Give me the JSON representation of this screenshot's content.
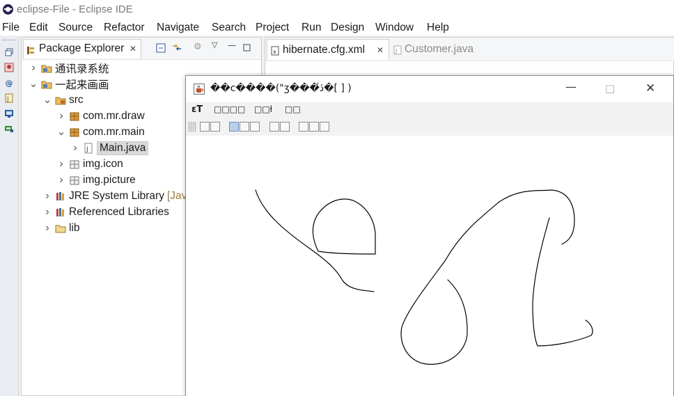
{
  "window": {
    "title": "eclipse-File - Eclipse IDE"
  },
  "menu": [
    "File",
    "Edit",
    "Source",
    "Refactor",
    "Navigate",
    "Search",
    "Project",
    "Run",
    "Design",
    "Window",
    "Help"
  ],
  "package_explorer": {
    "tab_label": "Package Explorer",
    "tree": [
      {
        "label": "通讯录系统",
        "icon": "project-icon",
        "indent": 0,
        "chevron": "right"
      },
      {
        "label": "一起来画画",
        "icon": "project-icon",
        "indent": 0,
        "chevron": "down"
      },
      {
        "label": "src",
        "icon": "source-folder-icon",
        "indent": 1,
        "chevron": "down"
      },
      {
        "label": "com.mr.draw",
        "icon": "package-icon",
        "indent": 2,
        "chevron": "right"
      },
      {
        "label": "com.mr.main",
        "icon": "package-icon",
        "indent": 2,
        "chevron": "down"
      },
      {
        "label": "Main.java",
        "icon": "java-file-icon",
        "indent": 3,
        "chevron": "right",
        "selected": true
      },
      {
        "label": "img.icon",
        "icon": "package-folder-icon",
        "indent": 2,
        "chevron": "right"
      },
      {
        "label": "img.picture",
        "icon": "package-folder-icon",
        "indent": 2,
        "chevron": "right"
      },
      {
        "label": "JRE System Library",
        "suffix": "[Java",
        "icon": "library-icon",
        "indent": 1,
        "chevron": "right"
      },
      {
        "label": "Referenced Libraries",
        "icon": "library-icon",
        "indent": 1,
        "chevron": "right"
      },
      {
        "label": "lib",
        "icon": "folder-icon",
        "indent": 1,
        "chevron": "right"
      }
    ]
  },
  "editor": {
    "tabs": [
      {
        "label": "hibernate.cfg.xml",
        "active": true,
        "closable": true
      },
      {
        "label": "Customer.java",
        "active": false,
        "closable": false
      }
    ]
  },
  "swing_window": {
    "title": "��c����(\"ʒ���ڎ́�[ ] )",
    "menu": [
      "ɛT",
      "□□□□",
      "□□ł",
      "□□"
    ],
    "toolbar_groups": [
      2,
      3,
      2,
      3
    ],
    "controls": {
      "minimize": "—",
      "maximize": "□",
      "close": "✕"
    }
  },
  "colors": {
    "selection": "#d9d9d9",
    "accent": "#2c2255"
  }
}
